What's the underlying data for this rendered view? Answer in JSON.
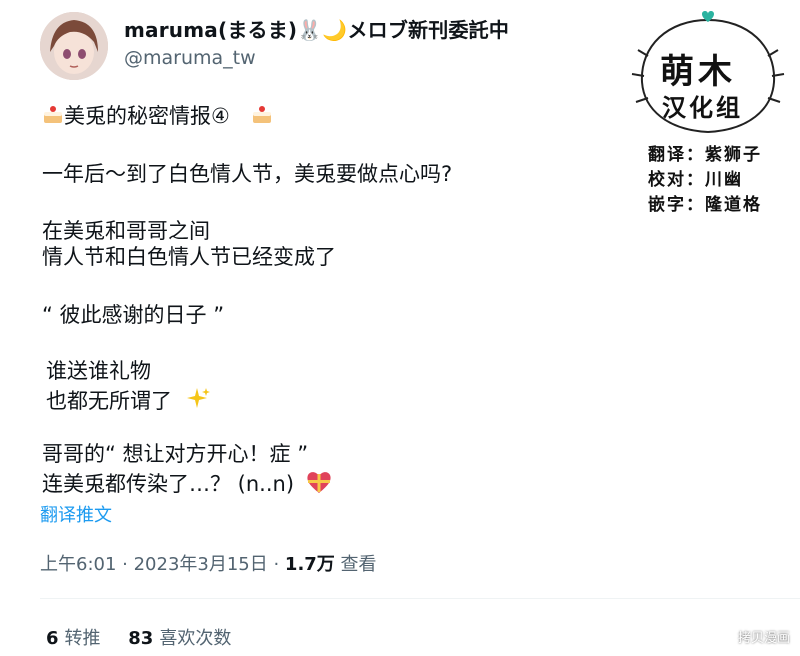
{
  "author": {
    "display_name": "maruma(まるま)🐰🌙メロブ新刊委託中",
    "handle": "@maruma_tw"
  },
  "tweet": {
    "lines": [
      "美兎的秘密情报④",
      "一年后～到了白色情人节，美兎要做点心吗?",
      "在美兎和哥哥之间",
      "情人节和白色情人节已经变成了",
      "“ 彼此感谢的日子 ”",
      "谁送谁礼物",
      "也都无所谓了",
      "哥哥的“ 想让对方开心！症 ”",
      "连美兎都传染了…？ (n..n)"
    ],
    "translate_label": "翻译推文",
    "time": "上午6:01 · 2023年3月15日 · ",
    "views_count": "1.7万",
    "views_label": " 查看"
  },
  "stats": {
    "retweets_count": "6",
    "retweets_label": "转推",
    "likes_count": "83",
    "likes_label": "喜欢次数"
  },
  "credits": {
    "group_name_1": "萌木",
    "group_name_2": "汉化组",
    "translator": "翻译：紫狮子",
    "proofreader": "校对：川幽",
    "typesetter": "嵌字：隆道格"
  },
  "watermark": "拷贝漫画",
  "icons": [
    "cake-icon",
    "sparkles-icon",
    "heart-gift-icon"
  ]
}
